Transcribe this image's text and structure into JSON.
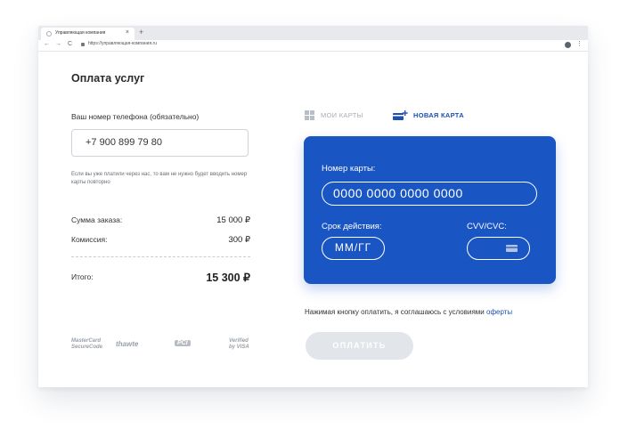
{
  "browser": {
    "tab_title": "Управляющая компания",
    "tab_close": "×",
    "new_tab": "+",
    "url": "https://управляющая-компания.ru",
    "back": "←",
    "forward": "→",
    "reload": "C",
    "menu": "⋮"
  },
  "page": {
    "title": "Оплата услуг",
    "phone_label": "Ваш номер телефона (обязательно)",
    "phone_value": "+7 900 899 79 80",
    "hint": "Если вы уже платили через нас, то вам не нужно будет вводить номер карты повторно",
    "summary": {
      "order_label": "Сумма заказа:",
      "order_value": "15 000 ₽",
      "fee_label": "Комиссия:",
      "fee_value": "300 ₽",
      "total_label": "Итого:",
      "total_value": "15 300 ₽"
    },
    "logos": [
      "MasterCard SecureCode",
      "thawte",
      "PCI",
      "Verified by VISA"
    ],
    "card_tabs": {
      "my_cards": "МОИ КАРТЫ",
      "new_card": "НОВАЯ КАРТА"
    },
    "card": {
      "number_label": "Номер карты:",
      "number_placeholder": "0000 0000 0000 0000",
      "expiry_label": "Срок действия:",
      "expiry_placeholder": "ММ/ГГ",
      "cvv_label": "CVV/CVC:"
    },
    "agreement_text": "Нажимая кнопку оплатить, я соглашаюсь с условиями",
    "agreement_link": "оферты",
    "pay_button": "ОПЛАТИТЬ"
  },
  "colors": {
    "accent": "#1d4fb4",
    "card_bg": "#1a55c4",
    "button_disabled": "#e2e5ea"
  }
}
